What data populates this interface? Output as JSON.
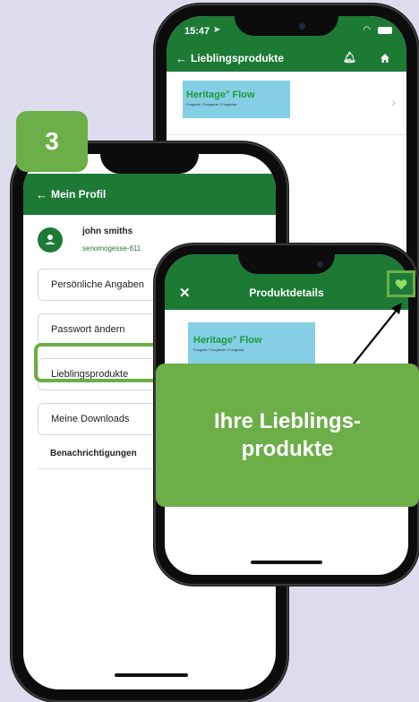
{
  "step_badge": "3",
  "back_phone": {
    "status_time": "15:47",
    "title": "Lieblingsprodukte",
    "banner_brand": "Heritage° Flow",
    "banner_sub": "Fungizid / Fungizide / Fungicida"
  },
  "left_phone": {
    "title": "Mein Profil",
    "user_name": "john smiths",
    "user_email": "senomogesse-611",
    "menu": [
      "Persönliche Angaben",
      "Passwort ändern",
      "Lieblingsprodukte",
      "Meine Downloads"
    ],
    "notifications_label": "Benachrichtigungen"
  },
  "front_phone": {
    "title": "Produktdetails",
    "banner_brand": "Heritage° Flow",
    "banner_sub": "Fungizid / Fungizide / Fungicida"
  },
  "callout_line1": "Ihre Lieblings-",
  "callout_line2": "produkte",
  "colors": {
    "brand_green": "#1c7a35",
    "accent_green": "#6cae48",
    "banner_blue": "#85cfe5"
  }
}
